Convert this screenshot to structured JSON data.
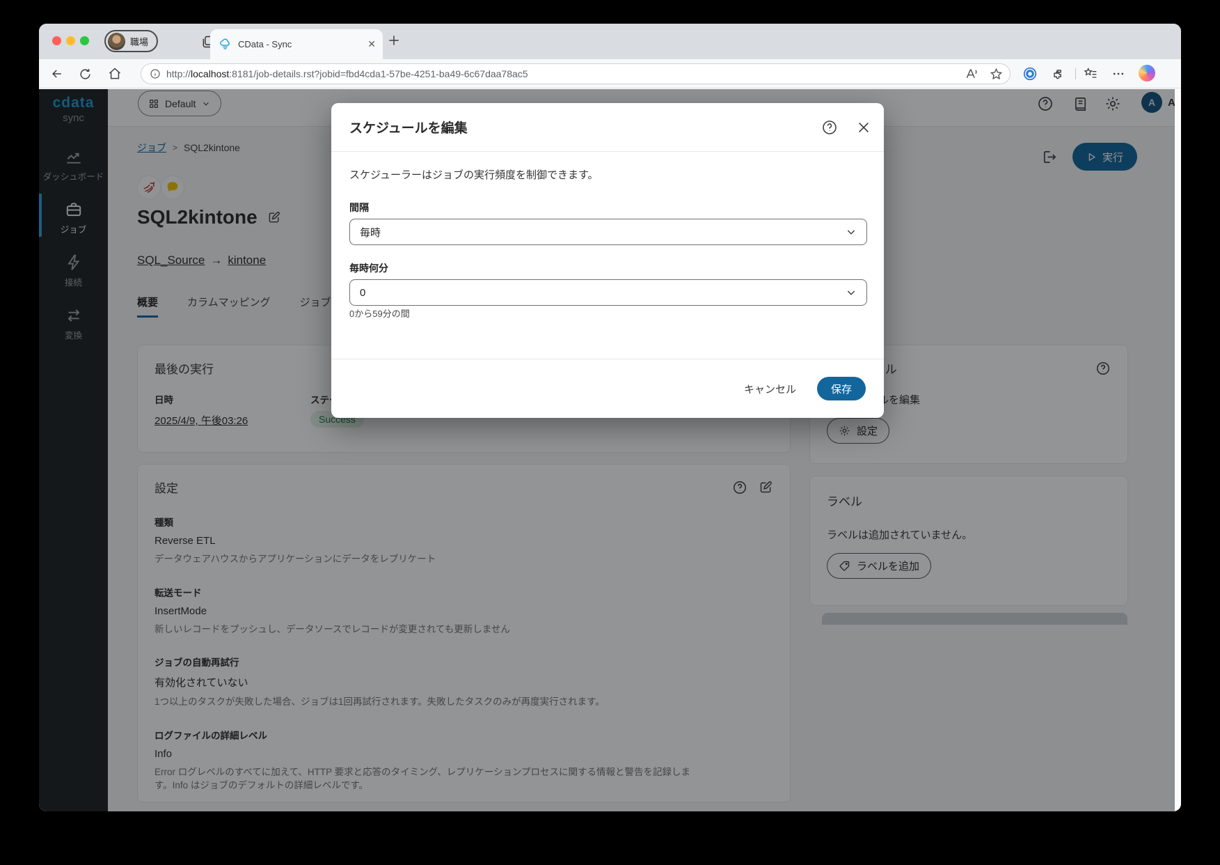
{
  "colors": {
    "primary": "#13669c",
    "sidebar_bg": "#1d2226",
    "accent_blue": "#2ba0d9",
    "status_green_text": "#1f7d4a",
    "status_green_bg": "#e4f3ea",
    "link_blue": "#176a9e"
  },
  "browser": {
    "profile_label": "職場",
    "tab_title": "CData - Sync",
    "new_tab": "+",
    "close_tab": "✕",
    "url_scheme": "http://",
    "url_host": "localhost",
    "url_rest": ":8181/job-details.rst?jobid=fbd4cda1-57be-4251-ba49-6c67daa78ac5"
  },
  "sidebar": {
    "logo": "cdata",
    "logo_sub": "sync",
    "items": [
      {
        "label": "ダッシュボード",
        "icon": "line-chart-icon",
        "active": false
      },
      {
        "label": "ジョブ",
        "icon": "briefcase-icon",
        "active": true
      },
      {
        "label": "接続",
        "icon": "lightning-icon",
        "active": false
      },
      {
        "label": "変換",
        "icon": "swap-arrows-icon",
        "active": false
      }
    ]
  },
  "header": {
    "workspace": "Default",
    "icons": [
      "help-icon",
      "release-notes-icon",
      "gear-icon"
    ],
    "admin_initial": "A",
    "admin_name": "Admin"
  },
  "page": {
    "breadcrumb": {
      "link": "ジョブ",
      "separator": ">",
      "current": "SQL2kintone"
    },
    "run_button": "実行",
    "title": "SQL2kintone",
    "source_link": "SQL_Source",
    "arrow": "→",
    "target_link": "kintone",
    "tabs": [
      {
        "label": "概要",
        "active": true
      },
      {
        "label": "カラムマッピング",
        "active": false
      },
      {
        "label": "ジョブ",
        "active": false
      }
    ],
    "last_run": {
      "title": "最後の実行",
      "datetime_label": "日時",
      "datetime_value": "2025/4/9, 午後03:26",
      "status_label": "ステータス",
      "status_value": "Success"
    },
    "settings": {
      "title": "設定",
      "fields": [
        {
          "label": "種類",
          "value": "Reverse ETL",
          "desc": "データウェアハウスからアプリケーションにデータをレプリケート"
        },
        {
          "label": "転送モード",
          "value": "InsertMode",
          "desc": "新しいレコードをプッシュし、データソースでレコードが変更されても更新しません"
        },
        {
          "label": "ジョブの自動再試行",
          "value": "有効化されていない",
          "desc": "1つ以上のタスクが失敗した場合、ジョブは1回再試行されます。失敗したタスクのみが再度実行されます。"
        },
        {
          "label": "ログファイルの詳細レベル",
          "value": "Info",
          "desc": "Error ログレベルのすべてに加えて、HTTP 要求と応答のタイミング、レプリケーションプロセスに関する情報と警告を記録します。Info はジョブのデフォルトの詳細レベルです。"
        }
      ]
    },
    "schedule_card": {
      "title": "スケジュール",
      "edit_text": "スケジュールを編集",
      "settings_button": "設定"
    },
    "labels_card": {
      "title": "ラベル",
      "empty_text": "ラベルは追加されていません。",
      "add_button": "ラベルを追加"
    }
  },
  "modal": {
    "title": "スケジュールを編集",
    "description": "スケジューラーはジョブの実行頻度を制御できます。",
    "interval_label": "間隔",
    "interval_value": "毎時",
    "minute_label": "毎時何分",
    "minute_value": "0",
    "minute_help": "0から59分の間",
    "cancel_button": "キャンセル",
    "save_button": "保存"
  }
}
